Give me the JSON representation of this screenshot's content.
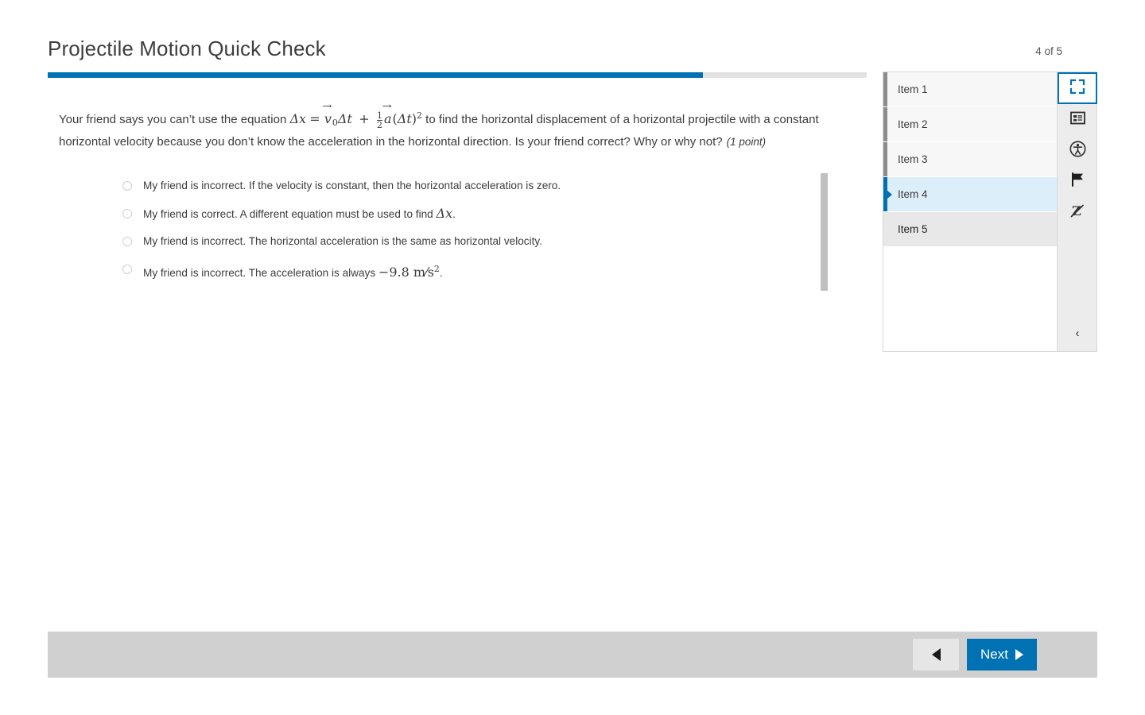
{
  "header": {
    "title": "Projectile Motion Quick Check",
    "counter": "4 of 5"
  },
  "progress": {
    "percent": 80,
    "fill_color": "#0071b3",
    "track_color": "#e2e2e2"
  },
  "question": {
    "text_before_equation": "Your friend says you can’t use the equation ",
    "equation": "Δx = v⃗0Δt + ½ a⃗(Δt)²",
    "equation_parts": {
      "delta_x": "Δx",
      "equals": "=",
      "v": "v",
      "v_sub": "0",
      "delta_t": "Δt",
      "plus": "+",
      "frac_num": "1",
      "frac_den": "2",
      "a": "a",
      "paren_open": "(",
      "paren_close": ")",
      "exponent": "2"
    },
    "text_after_equation": " to find the horizontal displacement of a horizontal projectile with a constant horizontal velocity because you don’t know the acceleration in the horizontal direction. Is your friend correct? Why or why not?",
    "points_label": "(1 point)"
  },
  "options": [
    {
      "id": "option-1",
      "text": "My friend is incorrect. If the velocity is constant, then the horizontal acceleration is zero.",
      "selected": false,
      "has_math": false
    },
    {
      "id": "option-2",
      "text_before": "My friend is correct. A different equation must be used to find ",
      "math": "Δx",
      "text_after": ".",
      "selected": false,
      "has_math": true
    },
    {
      "id": "option-3",
      "text": "My friend is incorrect. The horizontal acceleration is the same as horizontal velocity.",
      "selected": false,
      "has_math": false
    },
    {
      "id": "option-4",
      "text_before": "My friend is incorrect. The acceleration is always ",
      "math": "−9.8 m/s",
      "math_exponent": "2",
      "text_after": ".",
      "selected": false,
      "has_math": true
    }
  ],
  "item_list": [
    {
      "label": "Item 1",
      "state": "answered"
    },
    {
      "label": "Item 2",
      "state": "answered"
    },
    {
      "label": "Item 3",
      "state": "answered"
    },
    {
      "label": "Item 4",
      "state": "current"
    },
    {
      "label": "Item 5",
      "state": "hovered"
    }
  ],
  "tools": [
    {
      "name": "fullscreen-icon",
      "label": "Fullscreen",
      "selected": true
    },
    {
      "name": "notes-icon",
      "label": "Notes",
      "selected": false
    },
    {
      "name": "accessibility-icon",
      "label": "Accessibility",
      "selected": false
    },
    {
      "name": "flag-icon",
      "label": "Flag item",
      "selected": false
    },
    {
      "name": "no-sleep-icon",
      "label": "Disable Z",
      "selected": false
    }
  ],
  "collapse": {
    "glyph": "‹"
  },
  "footer": {
    "previous_label": "",
    "next_label": "Next"
  },
  "colors": {
    "accent": "#0071b3",
    "current_item_bg": "#ddeefb",
    "footer_bg": "#d0d0d0",
    "rail_bg": "#ececec"
  }
}
